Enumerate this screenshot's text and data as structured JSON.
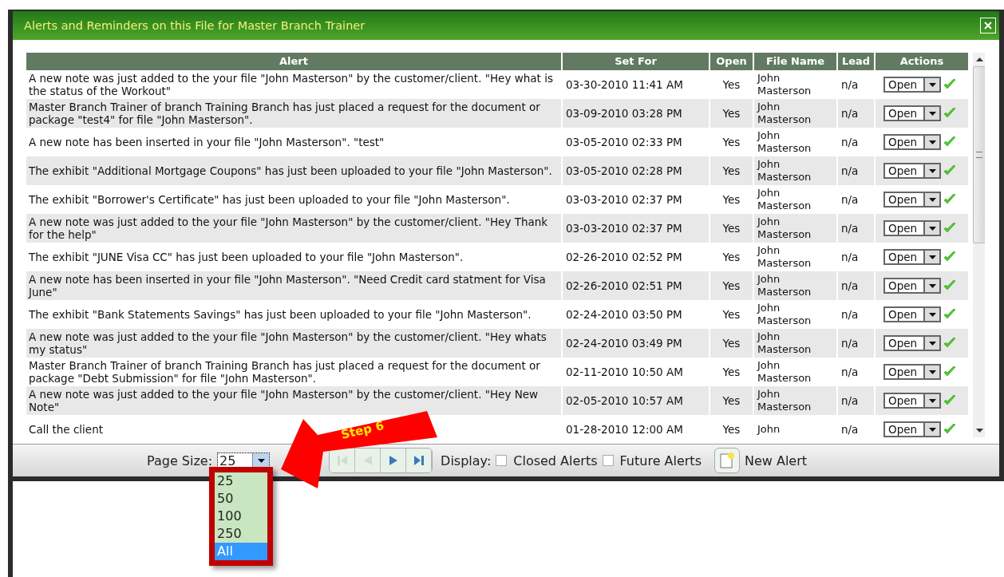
{
  "window": {
    "title": "Alerts and Reminders on this File for Master Branch Trainer"
  },
  "table": {
    "columns": [
      "Alert",
      "Set For",
      "Open",
      "File Name",
      "Lead",
      "Actions"
    ],
    "rows": [
      {
        "alert": "A new note was just added to the your file \"John Masterson\" by the customer/client. \"Hey what is the status of the Workout\"",
        "set_for": "03-30-2010 11:41 AM",
        "open": "Yes",
        "file_name": "John Masterson",
        "lead": "n/a",
        "action": "Open"
      },
      {
        "alert": "Master Branch Trainer of branch Training Branch has just placed a request for the document or package \"test4\" for file \"John Masterson\".",
        "set_for": "03-09-2010 03:28 PM",
        "open": "Yes",
        "file_name": "John Masterson",
        "lead": "n/a",
        "action": "Open"
      },
      {
        "alert": "A new note has been inserted in your file \"John Masterson\". \"test\"",
        "set_for": "03-05-2010 02:33 PM",
        "open": "Yes",
        "file_name": "John Masterson",
        "lead": "n/a",
        "action": "Open"
      },
      {
        "alert": "The exhibit \"Additional Mortgage Coupons\" has just been uploaded to your file \"John Masterson\".",
        "set_for": "03-05-2010 02:28 PM",
        "open": "Yes",
        "file_name": "John Masterson",
        "lead": "n/a",
        "action": "Open"
      },
      {
        "alert": "The exhibit \"Borrower's Certificate\" has just been uploaded to your file \"John Masterson\".",
        "set_for": "03-03-2010 02:37 PM",
        "open": "Yes",
        "file_name": "John Masterson",
        "lead": "n/a",
        "action": "Open"
      },
      {
        "alert": "A new note was just added to the your file \"John Masterson\" by the customer/client. \"Hey Thank for the help\"",
        "set_for": "03-03-2010 02:37 PM",
        "open": "Yes",
        "file_name": "John Masterson",
        "lead": "n/a",
        "action": "Open"
      },
      {
        "alert": "The exhibit \"JUNE Visa CC\" has just been uploaded to your file \"John Masterson\".",
        "set_for": "02-26-2010 02:52 PM",
        "open": "Yes",
        "file_name": "John Masterson",
        "lead": "n/a",
        "action": "Open"
      },
      {
        "alert": "A new note has been inserted in your file \"John Masterson\". \"Need Credit card statment for Visa June\"",
        "set_for": "02-26-2010 02:51 PM",
        "open": "Yes",
        "file_name": "John Masterson",
        "lead": "n/a",
        "action": "Open"
      },
      {
        "alert": "The exhibit \"Bank Statements Savings\" has just been uploaded to your file \"John Masterson\".",
        "set_for": "02-24-2010 03:50 PM",
        "open": "Yes",
        "file_name": "John Masterson",
        "lead": "n/a",
        "action": "Open"
      },
      {
        "alert": "A new note was just added to the your file \"John Masterson\" by the customer/client. \"Hey whats my status\"",
        "set_for": "02-24-2010 03:49 PM",
        "open": "Yes",
        "file_name": "John Masterson",
        "lead": "n/a",
        "action": "Open"
      },
      {
        "alert": "Master Branch Trainer of branch Training Branch has just placed a request for the document or package \"Debt Submission\" for file \"John Masterson\".",
        "set_for": "02-11-2010 10:50 AM",
        "open": "Yes",
        "file_name": "John Masterson",
        "lead": "n/a",
        "action": "Open"
      },
      {
        "alert": "A new note was just added to the your file \"John Masterson\" by the customer/client. \"Hey New Note\"",
        "set_for": "02-05-2010 10:57 AM",
        "open": "Yes",
        "file_name": "John Masterson",
        "lead": "n/a",
        "action": "Open"
      },
      {
        "alert": "Call the client",
        "set_for": "01-28-2010 12:00 AM",
        "open": "Yes",
        "file_name": "John",
        "lead": "n/a",
        "action": "Open"
      }
    ]
  },
  "footer": {
    "page_size_label": "Page Size:",
    "page_size": "25",
    "page_size_options": [
      {
        "label": "25",
        "selected": false
      },
      {
        "label": "50",
        "selected": false
      },
      {
        "label": "100",
        "selected": false
      },
      {
        "label": "250",
        "selected": false
      },
      {
        "label": "All",
        "selected": true
      }
    ],
    "pager": [
      {
        "kind": "first",
        "disabled": true
      },
      {
        "kind": "prev",
        "disabled": true
      },
      {
        "kind": "next",
        "disabled": false
      },
      {
        "kind": "last",
        "disabled": false
      }
    ],
    "display_label": "Display:",
    "filters": [
      {
        "label": "Closed Alerts",
        "checked": false
      },
      {
        "label": "Future Alerts",
        "checked": false
      }
    ],
    "new_alert": "New Alert"
  },
  "annotation": {
    "label": "Step 6"
  }
}
